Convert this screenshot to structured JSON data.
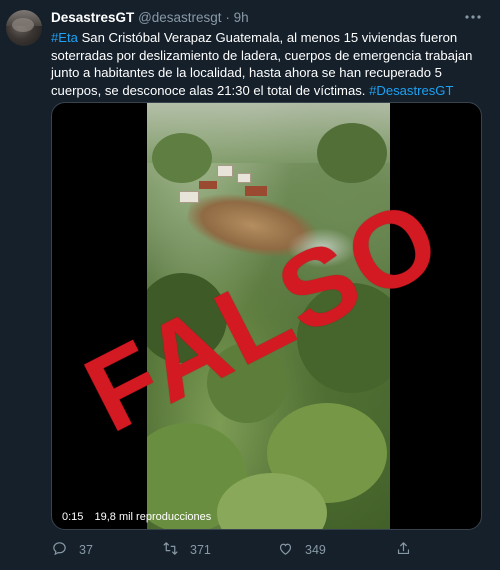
{
  "tweet": {
    "author_name": "DesastresGT",
    "author_handle": "@desastresgt",
    "separator": "·",
    "time": "9h",
    "text_hashtag_start": "#Eta",
    "text_body": " San Cristóbal Verapaz Guatemala, al menos 15 viviendas fueron soterradas por deslizamiento de ladera, cuerpos de emergencia trabajan junto a habitantes de la localidad, hasta ahora se han recuperado 5 cuerpos, se desconoce alas 21:30 el total de víctimas. ",
    "text_hashtag_end": "#DesastresGT"
  },
  "media": {
    "overlay_stamp": "FALSO",
    "video_time": "0:15",
    "video_views": "19,8 mil reproducciones"
  },
  "actions": {
    "reply_count": "37",
    "retweet_count": "371",
    "like_count": "349"
  },
  "icons": {
    "more": "more-icon",
    "reply": "reply-icon",
    "retweet": "retweet-icon",
    "like": "like-icon",
    "share": "share-icon"
  },
  "colors": {
    "background": "#15202b",
    "link": "#1da1f2",
    "muted": "#8899a6",
    "stamp": "#d31922"
  }
}
